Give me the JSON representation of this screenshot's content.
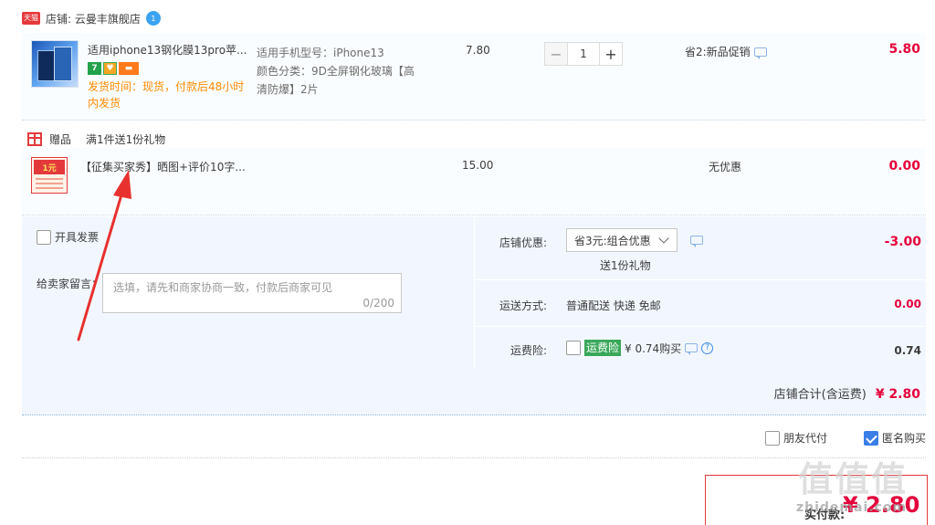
{
  "store": {
    "badge": "天猫",
    "name": "店铺: 云曼丰旗舰店",
    "ww": "1"
  },
  "item": {
    "title": "适用iphone13钢化膜13pro苹...",
    "tags": [
      "7",
      "♥",
      "▬"
    ],
    "ship_info": "发货时间：现货，付款后48小时内发货",
    "spec_model": "适用手机型号：iPhone13",
    "spec_color": "颜色分类：9D全屏钢化玻璃【高清防爆】2片",
    "unit_price": "7.80",
    "qty": "1",
    "minus": "−",
    "plus": "+",
    "promo": "省2:新品促销",
    "total": "5.80"
  },
  "gift": {
    "label": "赠品",
    "rule": "满1件送1份礼物",
    "thumb_text": "1元",
    "title": "【征集买家秀】晒图+评价10字...",
    "price": "15.00",
    "promo": "无优惠",
    "total": "0.00"
  },
  "order": {
    "invoice": "开具发票",
    "msg_label": "给卖家留言：",
    "msg_placeholder": "选填，请先和商家协商一致，付款后商家可见",
    "msg_count": "0/200",
    "discount_label": "店铺优惠:",
    "discount_select": "省3元:组合优惠",
    "discount_sub": "送1份礼物",
    "discount_value": "-3.00",
    "ship_label": "运送方式:",
    "ship_method": "普通配送 快递 免邮",
    "ship_value": "0.00",
    "ins_label": "运费险:",
    "ins_badge": "运费险",
    "ins_text": "¥ 0.74购买",
    "ins_value": "0.74",
    "store_total_label": "店铺合计(含运费)",
    "store_total_value": "¥ 2.80"
  },
  "options": {
    "friend_pay": "朋友代付",
    "anon_buy": "匿名购买"
  },
  "payment": {
    "label": "实付款:",
    "value": "¥ 2.80"
  },
  "watermark": {
    "main": "值值值",
    "sub": "zhidemai.com"
  },
  "colors": {
    "price_red": "#e4003a",
    "ship_orange": "#ff8a00",
    "accent_blue": "#3a7ee8",
    "insurance_green": "#3aa85a"
  }
}
